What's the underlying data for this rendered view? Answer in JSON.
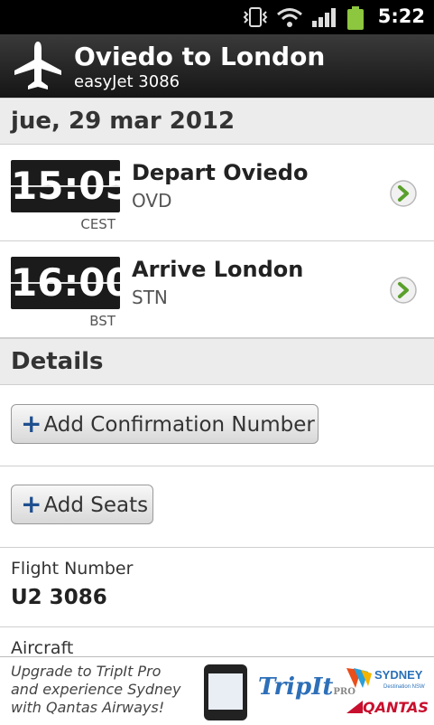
{
  "status_bar": {
    "time": "5:22"
  },
  "header": {
    "title": "Oviedo to London",
    "subtitle": "easyJet 3086"
  },
  "date_header": "jue, 29 mar 2012",
  "segments": [
    {
      "time": "15:05",
      "timezone": "CEST",
      "title": "Depart Oviedo",
      "code": "OVD"
    },
    {
      "time": "16:00",
      "timezone": "BST",
      "title": "Arrive London",
      "code": "STN"
    }
  ],
  "details_header": "Details",
  "buttons": {
    "add_confirmation": "Add Confirmation Number",
    "add_seats": "Add Seats",
    "plus": "+"
  },
  "fields": {
    "flight_number_label": "Flight Number",
    "flight_number_value": "U2 3086",
    "aircraft_label": "Aircraft"
  },
  "ad": {
    "text": "Upgrade to TripIt Pro and experience Sydney with Qantas Airways!",
    "tripit": "TripIt",
    "tripit_pro": "PRO",
    "sydney": "SYDNEY",
    "sydney_sub": "Destination NSW",
    "qantas": "QANTAS"
  }
}
